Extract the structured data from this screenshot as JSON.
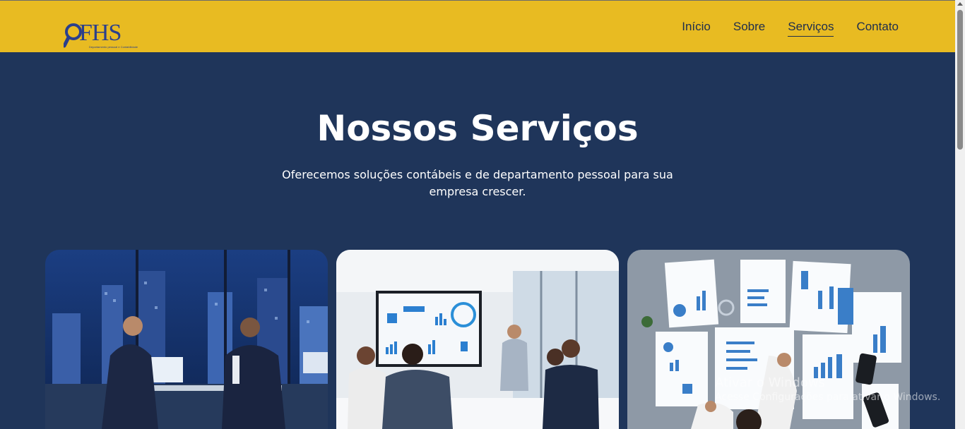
{
  "header": {
    "logo": {
      "text": "FHS",
      "subtext": "Departamento pessoal e Contabilidade"
    },
    "nav": [
      {
        "label": "Início",
        "active": false
      },
      {
        "label": "Sobre",
        "active": false
      },
      {
        "label": "Serviços",
        "active": true
      },
      {
        "label": "Contato",
        "active": false
      }
    ]
  },
  "hero": {
    "title": "Nossos Serviços",
    "subtitle": "Oferecemos soluções contábeis e de departamento pessoal para sua empresa crescer."
  },
  "cards": [
    {
      "image": "business-meeting-photo"
    },
    {
      "image": "presentation-photo"
    },
    {
      "image": "financial-reports-photo"
    }
  ],
  "watermark": {
    "line1": "Ativar o Windows",
    "line2": "Acesse Configurações para ativar o Windows."
  },
  "colors": {
    "header_bg": "#e8bb22",
    "page_bg": "#1f355a",
    "nav_text": "#1e2d4d"
  }
}
